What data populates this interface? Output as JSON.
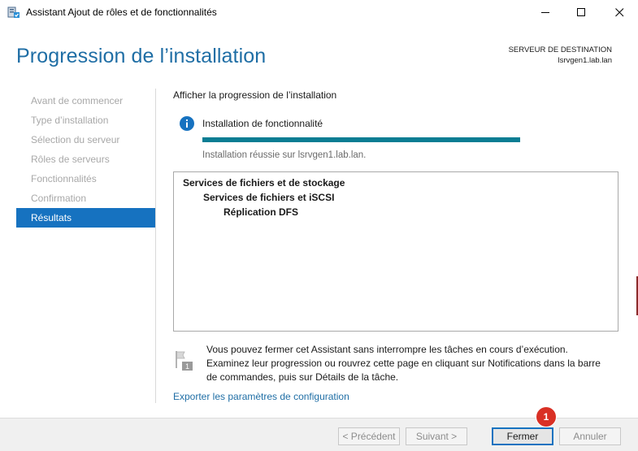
{
  "window": {
    "title": "Assistant Ajout de rôles et de fonctionnalités",
    "icons": {
      "app": "server-wizard-icon",
      "minimize": "minimize-icon",
      "maximize": "maximize-icon",
      "close": "close-icon"
    }
  },
  "header": {
    "title": "Progression de l’installation",
    "destination_label": "SERVEUR DE DESTINATION",
    "destination_server": "lsrvgen1.lab.lan"
  },
  "nav": {
    "items": [
      {
        "label": "Avant de commencer",
        "active": false
      },
      {
        "label": "Type d’installation",
        "active": false
      },
      {
        "label": "Sélection du serveur",
        "active": false
      },
      {
        "label": "Rôles de serveurs",
        "active": false
      },
      {
        "label": "Fonctionnalités",
        "active": false
      },
      {
        "label": "Confirmation",
        "active": false
      },
      {
        "label": "Résultats",
        "active": true
      }
    ]
  },
  "main": {
    "heading": "Afficher la progression de l’installation",
    "status_icon": "info-icon",
    "feature_label": "Installation de fonctionnalité",
    "progress": 1.0,
    "status_text": "Installation réussie sur lsrvgen1.lab.lan.",
    "results": [
      {
        "label": "Services de fichiers et de stockage",
        "level": 0
      },
      {
        "label": "Services de fichiers et iSCSI",
        "level": 1
      },
      {
        "label": "Réplication DFS",
        "level": 2
      }
    ],
    "note_icon": "notification-flag-icon",
    "note_badge": "1",
    "note": "Vous pouvez fermer cet Assistant sans interrompre les tâches en cours d’exécution. Examinez leur progression ou rouvrez cette page en cliquant sur Notifications dans la barre de commandes, puis sur Détails de la tâche.",
    "export_link": "Exporter les paramètres de configuration"
  },
  "footer": {
    "prev": "< Précédent",
    "next": "Suivant >",
    "close": "Fermer",
    "cancel": "Annuler"
  },
  "annotation": {
    "badge": "1"
  },
  "colors": {
    "title_blue": "#1f6ea5",
    "nav_active": "#1672c0",
    "progress": "#0a7d93",
    "badge_red": "#d93025"
  }
}
